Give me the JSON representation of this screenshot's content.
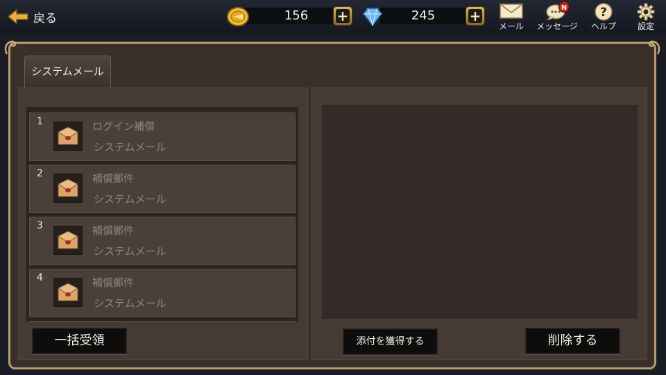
{
  "header": {
    "back_label": "戻る",
    "gold": "156",
    "gems": "245",
    "nav": {
      "mail_label": "メール",
      "message_label": "メッセージ",
      "message_badge": "N",
      "help_label": "ヘルプ",
      "settings_label": "設定"
    }
  },
  "tabs": [
    {
      "label": "システムメール"
    }
  ],
  "mail_list": [
    {
      "num": "1",
      "title": "ログイン補償",
      "sender": "システムメール"
    },
    {
      "num": "2",
      "title": "補償郵件",
      "sender": "システムメール"
    },
    {
      "num": "3",
      "title": "補償郵件",
      "sender": "システムメール"
    },
    {
      "num": "4",
      "title": "補償郵件",
      "sender": "システムメール"
    }
  ],
  "actions": {
    "claim_all_label": "一括受領",
    "get_attachment_label": "添付を獲得する",
    "delete_label": "削除する"
  },
  "colors": {
    "frame_border": "#b89c6a",
    "panel_bg": "#453a34",
    "gold_plus": "#d9b85a"
  }
}
